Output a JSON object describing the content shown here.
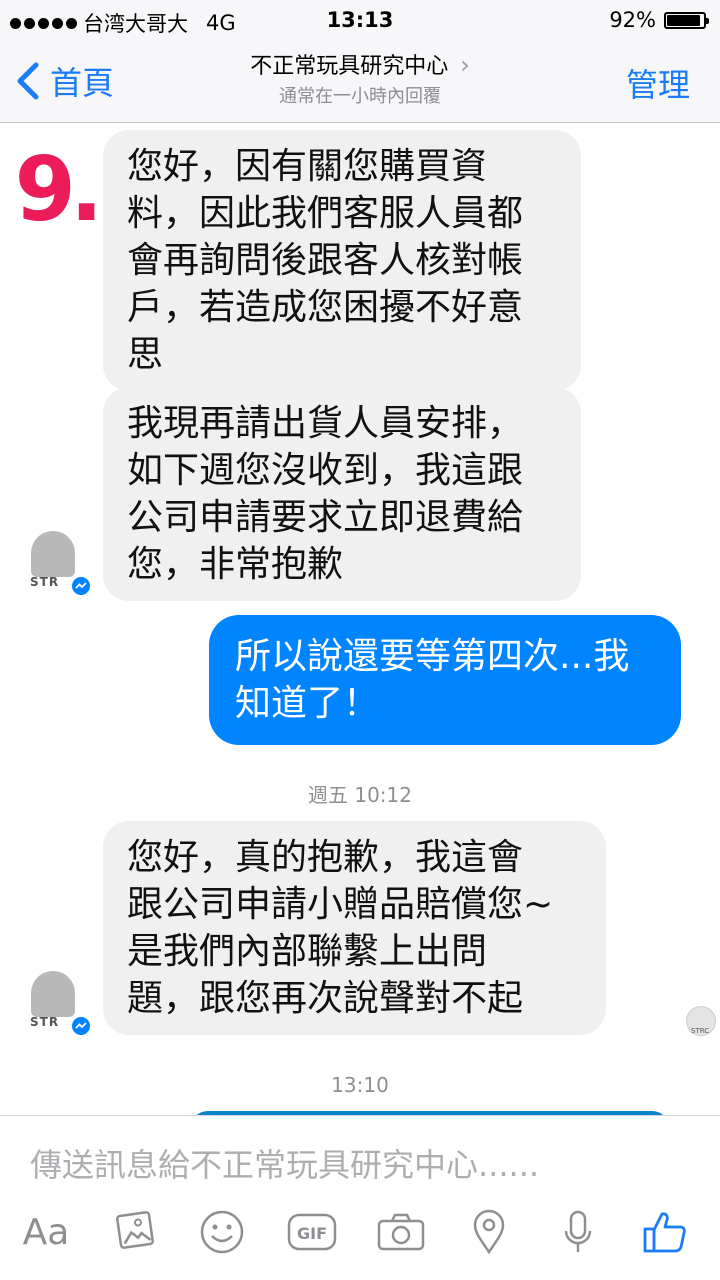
{
  "status_bar": {
    "carrier": "台湾大哥大",
    "network": "4G",
    "time": "13:13",
    "battery_percent": "92%",
    "battery_level": 0.92
  },
  "nav": {
    "back_label": "首頁",
    "title": "不正常玩具研究中心",
    "subtitle": "通常在一小時內回覆",
    "manage_label": "管理"
  },
  "chat": {
    "sticker_text": "9.",
    "messages": [
      {
        "text": "您好，因有關您購買資\n料，因此我們客服人員都\n會再詢問後跟客人核對帳\n戶，若造成您困擾不好意\n思"
      },
      {
        "text": "我現再請出貨人員安排，\n如下週您沒收到，我這跟\n公司申請要求立即退費給\n您，非常抱歉"
      },
      {
        "text": "所以說還要等第四次...我\n知道了！"
      },
      {
        "text": "您好，真的抱歉，我這會\n跟公司申請小贈品賠償您~\n是我們內部聯繫上出問\n題，跟您再次說聲對不起"
      }
    ],
    "timestamps": [
      "週五 10:12",
      "13:10"
    ],
    "avatar_text": "STR",
    "read_receipt_text": "STRC"
  },
  "composer": {
    "placeholder": "傳送訊息給不正常玩具研究中心......",
    "aa_label": "Aa",
    "gif_label": "GIF"
  },
  "colors": {
    "accent": "#1a7cf6",
    "outgoing_bubble": "#0084ff",
    "incoming_bubble": "#f1f0f0",
    "sticker": "#ec1c5a"
  }
}
